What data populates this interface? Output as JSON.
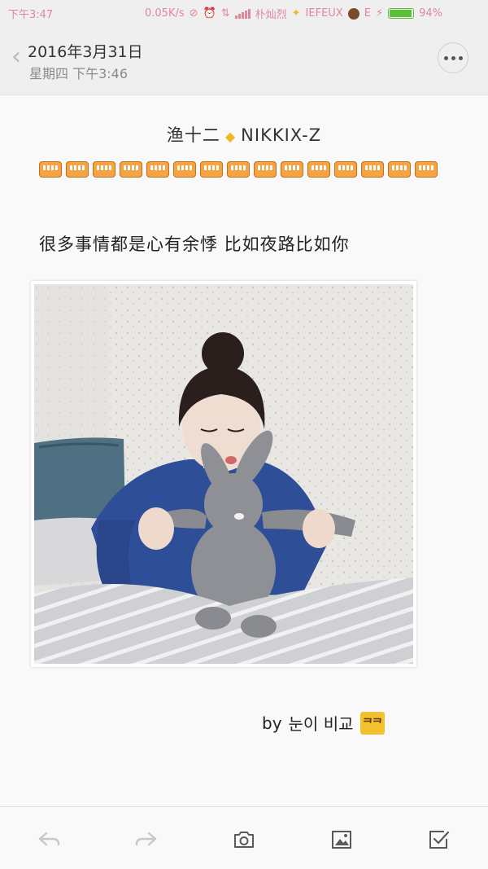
{
  "status_bar": {
    "time": "下午3:47",
    "speed": "0.05K/s",
    "carrier": "朴灿烈",
    "carrier2": "IEFEUX",
    "network": "E",
    "battery": "94%",
    "battery_level": 0.94,
    "accent_color": "#e0879a"
  },
  "header": {
    "date": "2016年3月31日",
    "subdate": "星期四 下午3:46",
    "back_icon": "chevron-left-icon",
    "more_icon": "more-dots-icon"
  },
  "note": {
    "title_left": "渔十二",
    "title_separator": "◆",
    "title_right": "NIKKIX-Z",
    "emoji_row_count": 15,
    "quote": "很多事情都是心有余悸 比如夜路比如你",
    "signature_prefix": "by",
    "signature_name": "눈이 비교",
    "badge_text": "ᄏᄏ"
  },
  "toolbar": {
    "items": [
      "undo-icon",
      "redo-icon",
      "camera-icon",
      "image-icon",
      "checkbox-icon"
    ]
  }
}
